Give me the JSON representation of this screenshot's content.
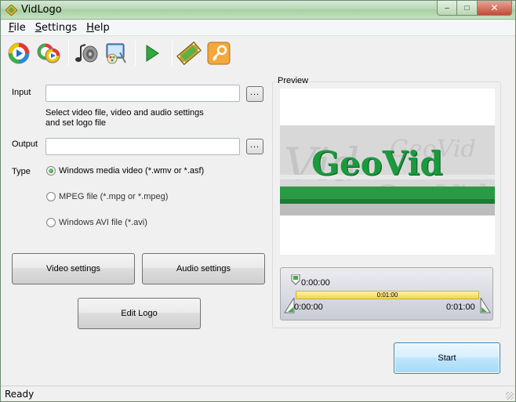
{
  "window": {
    "title": "VidLogo",
    "min_label": "–",
    "max_label": "□",
    "close_label": "✕"
  },
  "menu": [
    {
      "key": "F",
      "rest": "ile"
    },
    {
      "key": "S",
      "rest": "ettings"
    },
    {
      "key": "H",
      "rest": "elp"
    }
  ],
  "toolbar": {
    "icons": [
      "play-icon",
      "play-batch-icon",
      "music-notes-icon",
      "video-settings-icon",
      "run-icon",
      "film-icon",
      "key-icon"
    ]
  },
  "form": {
    "input_label": "Input",
    "input_value": "",
    "browse_label": "...",
    "hint_line1": "Select video file, video and audio settings",
    "hint_line2": "and set logo file",
    "output_label": "Output",
    "output_value": "",
    "type_label": "Type",
    "types": [
      {
        "label": "Windows media video (*.wmv or *.asf)",
        "selected": true
      },
      {
        "label": "MPEG file (*.mpg or *.mpeg)",
        "selected": false
      },
      {
        "label": "Windows AVI file (*.avi)",
        "selected": false
      }
    ]
  },
  "buttons": {
    "video_settings": "Video settings",
    "audio_settings": "Audio settings",
    "edit_logo": "Edit Logo",
    "start": "Start"
  },
  "preview": {
    "title": "Preview",
    "logo_text": "GeoVid"
  },
  "timeline": {
    "marker_top": "0:00:00",
    "bar_label": "0:01:00",
    "start": "0:00:00",
    "end": "0:01:00"
  },
  "status": {
    "text": "Ready"
  },
  "colors": {
    "accent": "#1f8f3a",
    "logo_green": "#1a9a3c"
  }
}
